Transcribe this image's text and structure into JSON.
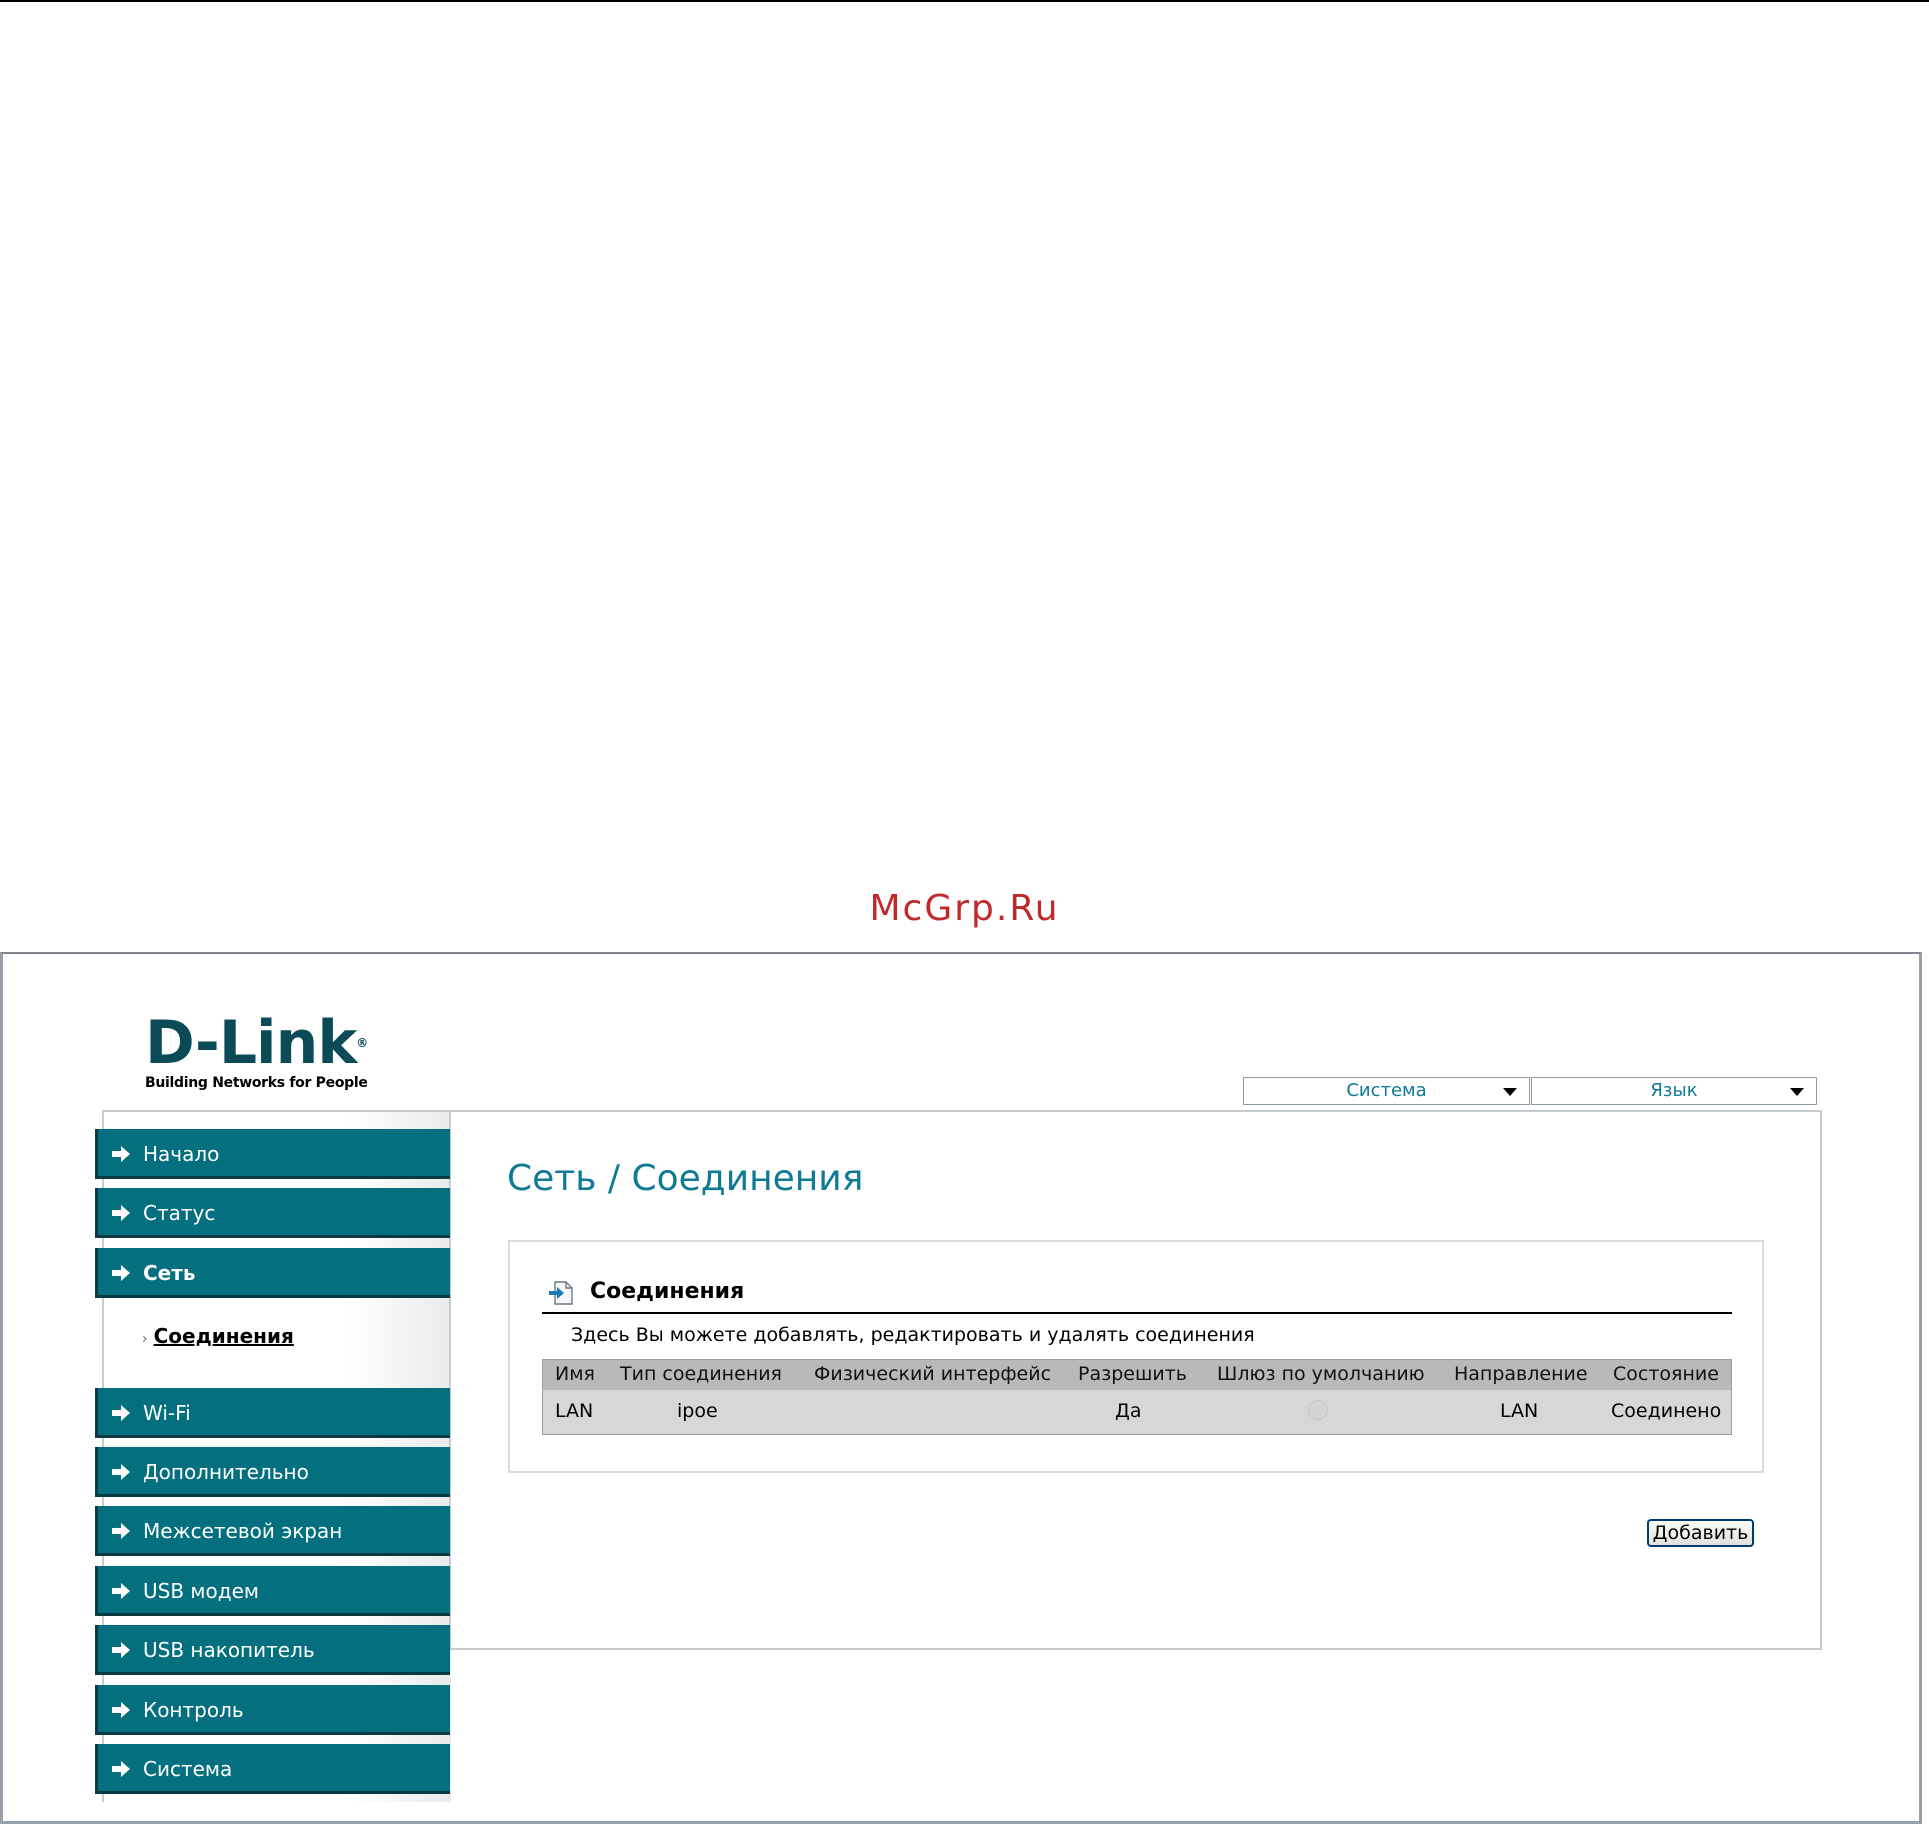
{
  "watermark": "McGrp.Ru",
  "brand": {
    "name": "D-Link",
    "registered": "®",
    "tagline": "Building Networks for People"
  },
  "top_menus": {
    "system_label": "Система",
    "language_label": "Язык"
  },
  "sidebar": {
    "items": [
      {
        "label": "Начало"
      },
      {
        "label": "Статус"
      },
      {
        "label": "Сеть"
      },
      {
        "label": "Wi-Fi"
      },
      {
        "label": "Дополнительно"
      },
      {
        "label": "Межсетевой экран"
      },
      {
        "label": "USB модем"
      },
      {
        "label": "USB накопитель"
      },
      {
        "label": "Контроль"
      },
      {
        "label": "Система"
      }
    ],
    "active_item": "Сеть",
    "subitems": [
      {
        "label": "Соединения",
        "active": true
      }
    ]
  },
  "page": {
    "title": "Сеть / Соединения"
  },
  "section": {
    "title": "Соединения",
    "description": "Здесь Вы можете добавлять, редактировать и удалять соединения"
  },
  "table": {
    "columns": [
      "Имя",
      "Тип соединения",
      "Физический интерфейс",
      "Разрешить",
      "Шлюз по умолчанию",
      "Направление",
      "Состояние"
    ],
    "rows": [
      {
        "name": "LAN",
        "type": "ipoe",
        "interface": "",
        "enabled": "Да",
        "default_gateway": false,
        "direction": "LAN",
        "state": "Соединено"
      }
    ]
  },
  "actions": {
    "add_label": "Добавить"
  },
  "colors": {
    "accent": "#0f7a95",
    "nav_bg": "#046f7f",
    "watermark": "#c0282b"
  }
}
